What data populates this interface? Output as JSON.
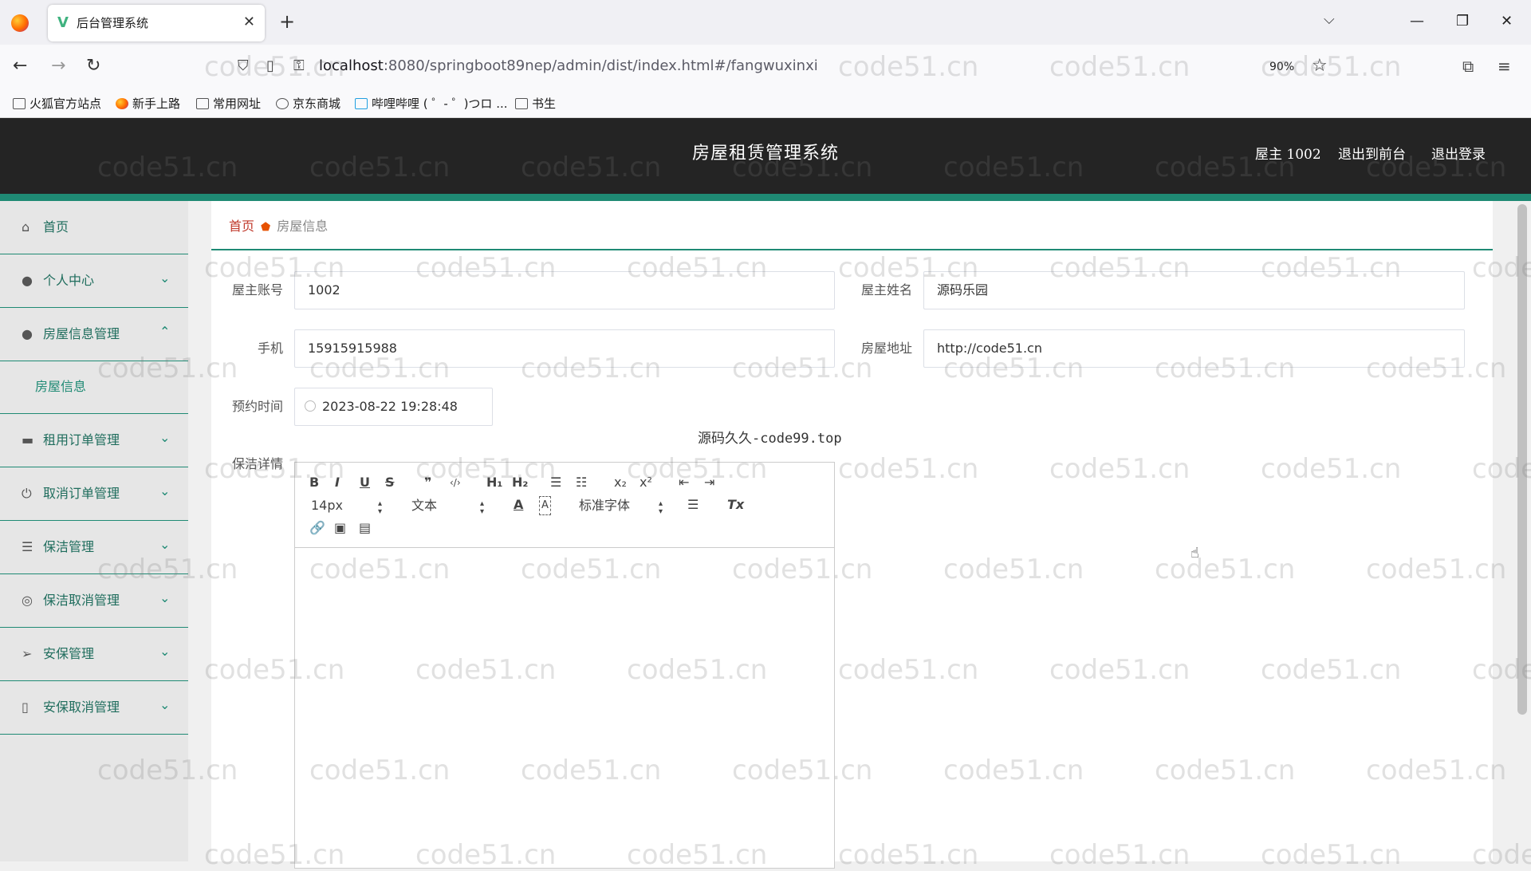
{
  "browser": {
    "tab_title": "后台管理系统",
    "tab_icon": "V",
    "tab_close": "✕",
    "new_tab": "+",
    "tab_list": "⌵",
    "window_controls": [
      "—",
      "❐",
      "✕"
    ],
    "url_host": "localhost",
    "url_rest": ":8080/springboot89nep/admin/dist/index.html#/fangwuxinxi",
    "zoom": "90%",
    "bookmarks": [
      "火狐官方站点",
      "新手上路",
      "常用网址",
      "京东商城",
      "哔哩哔哩 ( ゜- ゜)つロ ...",
      "书生"
    ]
  },
  "header": {
    "title": "房屋租赁管理系统",
    "user": "屋主 1002",
    "back_to_front": "退出到前台",
    "logout": "退出登录"
  },
  "sidebar": {
    "items": [
      {
        "label": "首页",
        "icon": "home-icon",
        "arrow": ""
      },
      {
        "label": "个人中心",
        "icon": "person-icon",
        "arrow": "⌄"
      },
      {
        "label": "房屋信息管理",
        "icon": "person-icon",
        "arrow": "⌃"
      },
      {
        "label": "房屋信息",
        "icon": "",
        "arrow": ""
      },
      {
        "label": "租用订单管理",
        "icon": "briefcase-icon",
        "arrow": "⌄"
      },
      {
        "label": "取消订单管理",
        "icon": "power-icon",
        "arrow": "⌄"
      },
      {
        "label": "保洁管理",
        "icon": "list-icon",
        "arrow": "⌄"
      },
      {
        "label": "保洁取消管理",
        "icon": "compass-icon",
        "arrow": "⌄"
      },
      {
        "label": "安保管理",
        "icon": "send-icon",
        "arrow": "⌄"
      },
      {
        "label": "安保取消管理",
        "icon": "mobile-icon",
        "arrow": "⌄"
      }
    ]
  },
  "breadcrumb": {
    "home": "首页",
    "current": "房屋信息"
  },
  "form": {
    "owner_account_label": "屋主账号",
    "owner_account_value": "1002",
    "owner_name_label": "屋主姓名",
    "owner_name_value": "源码乐园",
    "phone_label": "手机",
    "phone_value": "15915915988",
    "address_label": "房屋地址",
    "address_value": "http://code51.cn",
    "reserve_time_label": "预约时间",
    "reserve_time_value": "2023-08-22 19:28:48",
    "cleaning_details_label": "保洁详情"
  },
  "source_note": "源码久久-code99.top",
  "editor_toolbar": {
    "row1": [
      "B",
      "I",
      "U",
      "S",
      "❞",
      "‹/›",
      "H₁",
      "H₂",
      "☰",
      "☷",
      "x₂",
      "x²",
      "⇤",
      "⇥"
    ],
    "size_select": "14px",
    "header_select": "文本",
    "color": "A",
    "background": "A",
    "font_select": "标准字体",
    "align": "☰",
    "clean": "Tx",
    "row3": [
      "🔗",
      "▣",
      "▤"
    ]
  },
  "watermark_text": "code51.cn"
}
